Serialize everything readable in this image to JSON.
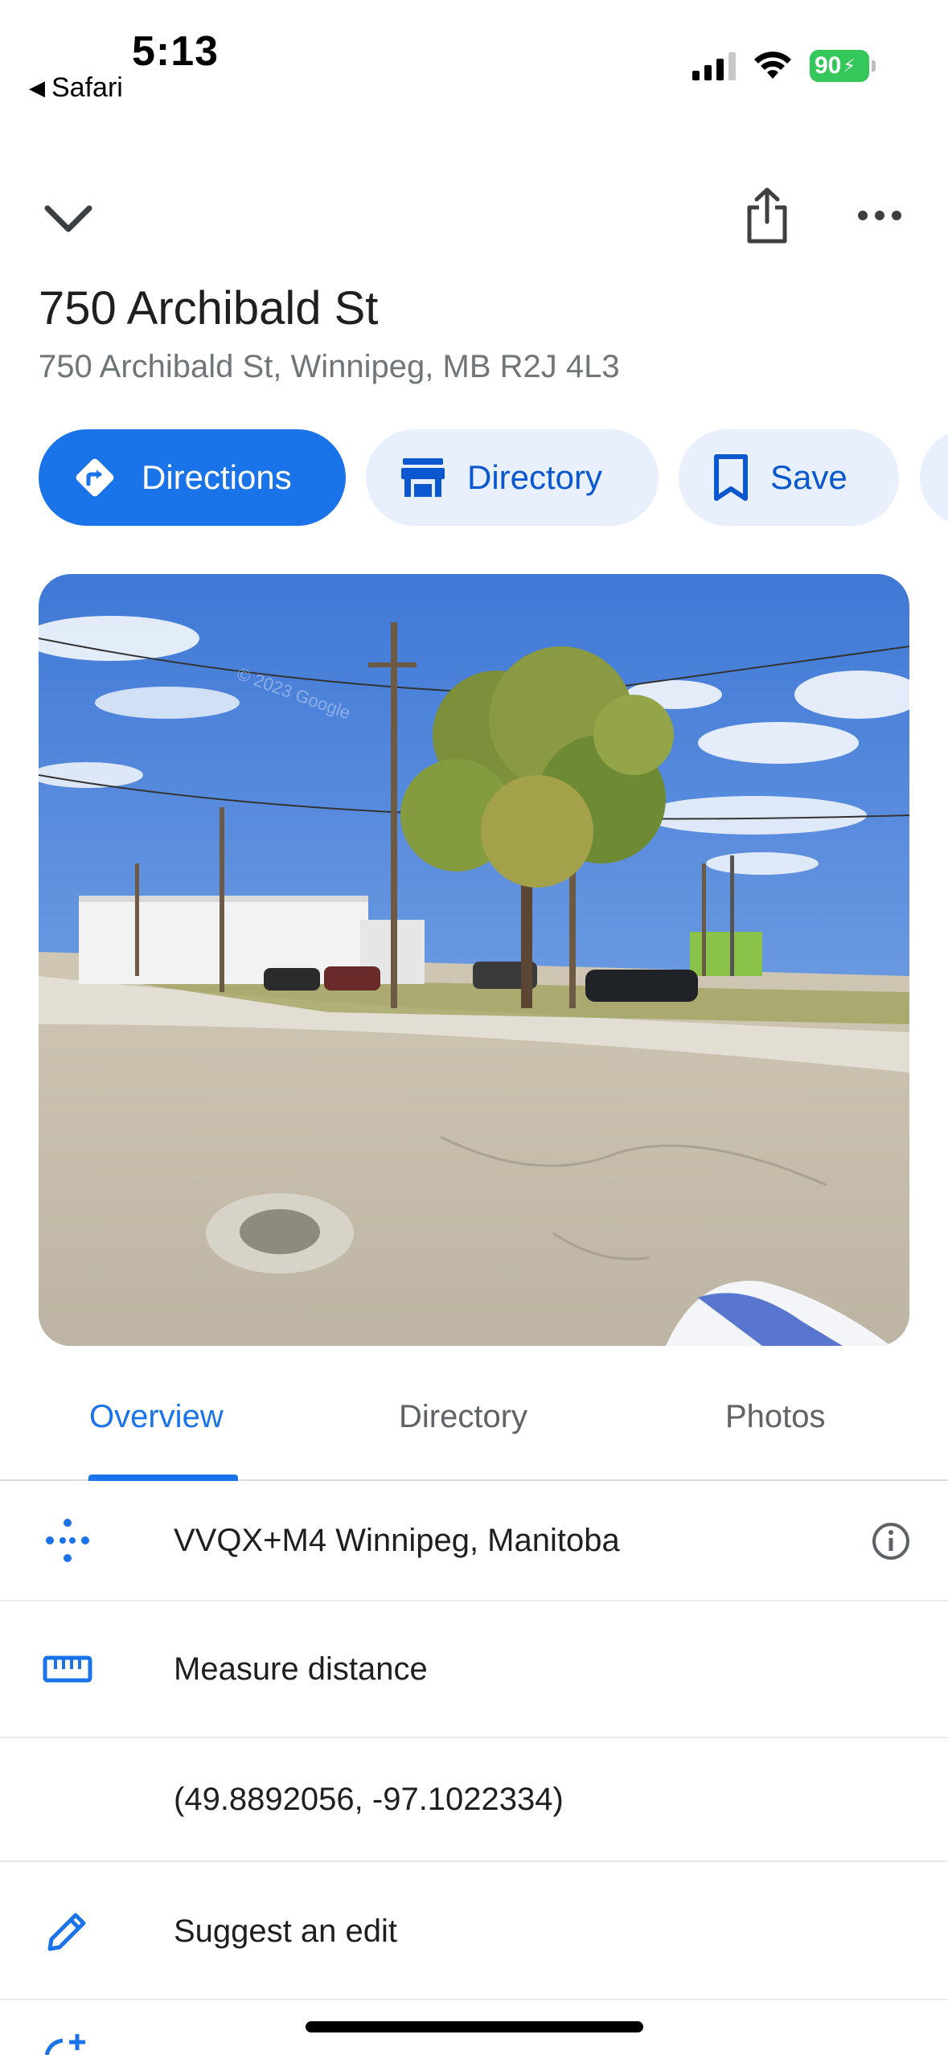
{
  "status_bar": {
    "time": "5:13",
    "back_app": "Safari",
    "battery": "90"
  },
  "place": {
    "title": "750 Archibald St",
    "address": "750 Archibald St, Winnipeg, MB R2J 4L3"
  },
  "chips": [
    {
      "label": "Directions",
      "icon": "directions-icon"
    },
    {
      "label": "Directory",
      "icon": "storefront-icon"
    },
    {
      "label": "Save",
      "icon": "bookmark-icon"
    }
  ],
  "photo": {
    "watermark": "© 2023 Google"
  },
  "tabs": [
    {
      "label": "Overview",
      "active": true
    },
    {
      "label": "Directory",
      "active": false
    },
    {
      "label": "Photos",
      "active": false
    }
  ],
  "rows": [
    {
      "text": "VVQX+M4 Winnipeg, Manitoba",
      "icon": "plus-code-icon"
    },
    {
      "text": "Measure distance",
      "icon": "ruler-icon"
    },
    {
      "text": "(49.8892056, -97.1022334)",
      "icon": ""
    },
    {
      "text": "Suggest an edit",
      "icon": "pencil-icon"
    }
  ],
  "colors": {
    "accent": "#1a73e8",
    "chip_bg": "#e8f0fe",
    "chip_text": "#0b57d0",
    "battery": "#34c759"
  }
}
